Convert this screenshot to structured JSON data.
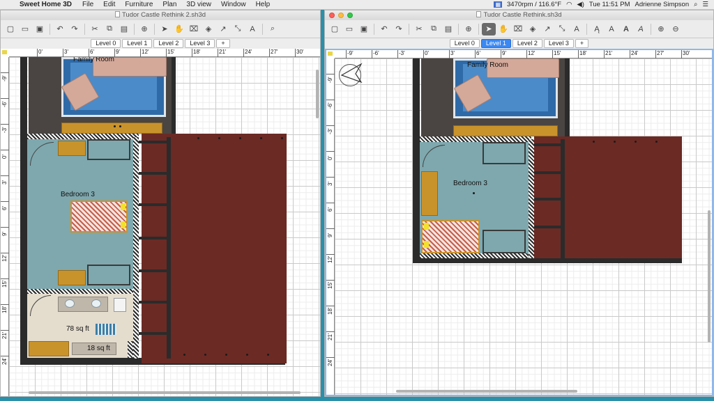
{
  "menubar": {
    "app_name": "Sweet Home 3D",
    "menus": [
      "File",
      "Edit",
      "Furniture",
      "Plan",
      "3D view",
      "Window",
      "Help"
    ],
    "cpu_status": "3470rpm / 116.6°F",
    "clock": "Tue 11:51 PM",
    "user": "Adrienne Simpson"
  },
  "left_window": {
    "title": "Tudor Castle Rethink 2.sh3d",
    "levels": [
      "Level 0",
      "Level 1",
      "Level 2",
      "Level 3",
      "+"
    ],
    "active_level": "Level 1",
    "ruler_x": [
      "0'",
      "3'",
      "6'",
      "9'",
      "12'",
      "15'",
      "18'",
      "21'",
      "24'",
      "27'",
      "30'"
    ],
    "ruler_y": [
      "-9'",
      "-6'",
      "-3'",
      "0'",
      "3'",
      "6'",
      "9'",
      "12'",
      "15'",
      "18'",
      "21'",
      "24'"
    ],
    "rooms": {
      "family_room": "Family Room",
      "bedroom": "Bedroom 3",
      "bath_area": "78 sq ft",
      "closet_area": "18 sq ft"
    }
  },
  "right_window": {
    "title": "Tudor Castle Rethink.sh3d",
    "levels": [
      "Level 0",
      "Level 1",
      "Level 2",
      "Level 3",
      "+"
    ],
    "active_level": "Level 1",
    "ruler_x": [
      "-9'",
      "-6'",
      "-3'",
      "0'",
      "3'",
      "6'",
      "9'",
      "12'",
      "15'",
      "18'",
      "21'",
      "24'",
      "27'",
      "30'"
    ],
    "ruler_y": [
      "-9'",
      "-6'",
      "-3'",
      "0'",
      "3'",
      "6'",
      "9'",
      "12'",
      "15'",
      "18'",
      "21'",
      "24'"
    ],
    "rooms": {
      "family_room": "Family Room",
      "bedroom": "Bedroom 3"
    }
  },
  "toolbar_icons": [
    "new-icon",
    "open-icon",
    "save-icon",
    "undo-icon",
    "redo-icon",
    "cut-icon",
    "copy-icon",
    "paste-icon",
    "add-furniture-icon",
    "select-icon",
    "pan-icon",
    "create-walls-icon",
    "create-rooms-icon",
    "create-polylines-icon",
    "create-dimensions-icon",
    "add-text-icon",
    "zoom-icon"
  ],
  "colors": {
    "active_tab": "#3a88f2",
    "floor_brown": "#6b2a24",
    "floor_blue": "#7ea8ae",
    "wall": "#2b2b2b"
  }
}
